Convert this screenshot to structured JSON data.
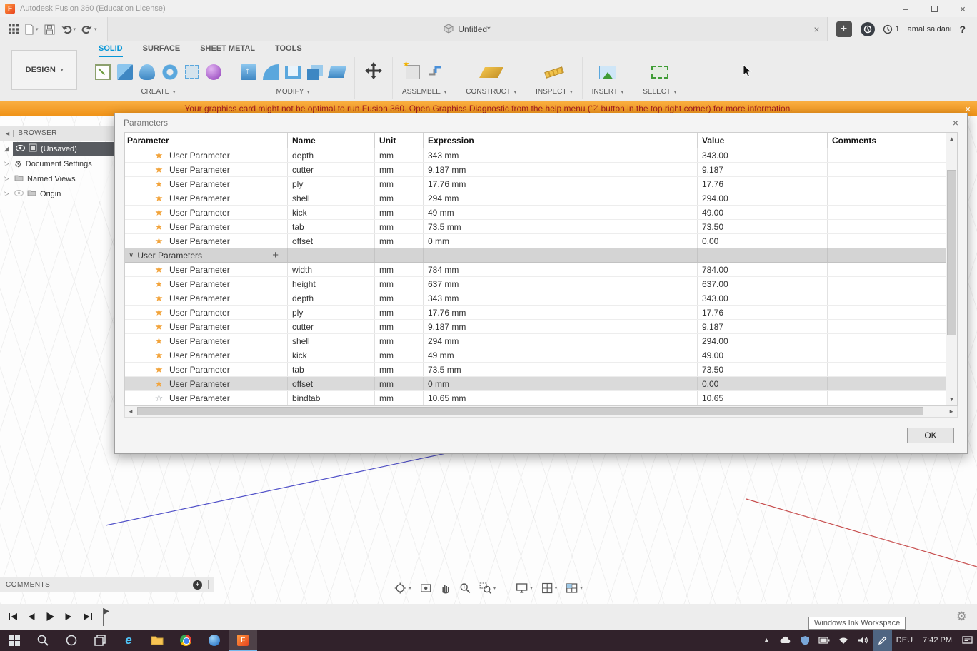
{
  "titlebar": {
    "title": "Autodesk Fusion 360 (Education License)"
  },
  "tabstrip": {
    "document_tab": "Untitled*",
    "notification_count": "1",
    "user_name": "amal saidani"
  },
  "ribbon": {
    "design_label": "DESIGN",
    "tabs": {
      "solid": "SOLID",
      "surface": "SURFACE",
      "sheet_metal": "SHEET METAL",
      "tools": "TOOLS"
    },
    "groups": {
      "create": "CREATE",
      "modify": "MODIFY",
      "assemble": "ASSEMBLE",
      "construct": "CONSTRUCT",
      "inspect": "INSPECT",
      "insert": "INSERT",
      "select": "SELECT"
    }
  },
  "warning": {
    "text": "Your graphics card might not be optimal to run Fusion 360. Open Graphics Diagnostic from the help menu ('?' button in the top right corner) for more information."
  },
  "browser": {
    "header": "BROWSER",
    "root_label": "(Unsaved)",
    "items": [
      {
        "label": "Document Settings"
      },
      {
        "label": "Named Views"
      },
      {
        "label": "Origin"
      }
    ]
  },
  "dialog": {
    "title": "Parameters",
    "columns": [
      "Parameter",
      "Name",
      "Unit",
      "Expression",
      "Value",
      "Comments"
    ],
    "row_type_label": "User Parameter",
    "section_label": "User Parameters",
    "favorites_section": [
      {
        "name": "depth",
        "unit": "mm",
        "expression": "343 mm",
        "value": "343.00",
        "favorite": true
      },
      {
        "name": "cutter",
        "unit": "mm",
        "expression": "9.187 mm",
        "value": "9.187",
        "favorite": true
      },
      {
        "name": "ply",
        "unit": "mm",
        "expression": "17.76 mm",
        "value": "17.76",
        "favorite": true
      },
      {
        "name": "shell",
        "unit": "mm",
        "expression": "294 mm",
        "value": "294.00",
        "favorite": true
      },
      {
        "name": "kick",
        "unit": "mm",
        "expression": "49 mm",
        "value": "49.00",
        "favorite": true
      },
      {
        "name": "tab",
        "unit": "mm",
        "expression": "73.5 mm",
        "value": "73.50",
        "favorite": true
      },
      {
        "name": "offset",
        "unit": "mm",
        "expression": "0 mm",
        "value": "0.00",
        "favorite": true
      }
    ],
    "user_parameters": [
      {
        "name": "width",
        "unit": "mm",
        "expression": "784 mm",
        "value": "784.00",
        "favorite": true
      },
      {
        "name": "height",
        "unit": "mm",
        "expression": "637 mm",
        "value": "637.00",
        "favorite": true
      },
      {
        "name": "depth",
        "unit": "mm",
        "expression": "343 mm",
        "value": "343.00",
        "favorite": true
      },
      {
        "name": "ply",
        "unit": "mm",
        "expression": "17.76 mm",
        "value": "17.76",
        "favorite": true
      },
      {
        "name": "cutter",
        "unit": "mm",
        "expression": "9.187 mm",
        "value": "9.187",
        "favorite": true
      },
      {
        "name": "shell",
        "unit": "mm",
        "expression": "294 mm",
        "value": "294.00",
        "favorite": true
      },
      {
        "name": "kick",
        "unit": "mm",
        "expression": "49 mm",
        "value": "49.00",
        "favorite": true
      },
      {
        "name": "tab",
        "unit": "mm",
        "expression": "73.5 mm",
        "value": "73.50",
        "favorite": true
      },
      {
        "name": "offset",
        "unit": "mm",
        "expression": "0 mm",
        "value": "0.00",
        "favorite": true,
        "selected": true
      },
      {
        "name": "bindtab",
        "unit": "mm",
        "expression": "10.65 mm",
        "value": "10.65",
        "favorite": false
      }
    ],
    "ok_label": "OK"
  },
  "comments_bar": {
    "label": "COMMENTS"
  },
  "tooltip": {
    "text": "Windows Ink Workspace"
  },
  "taskbar": {
    "language": "DEU",
    "time": "7:42 PM"
  }
}
